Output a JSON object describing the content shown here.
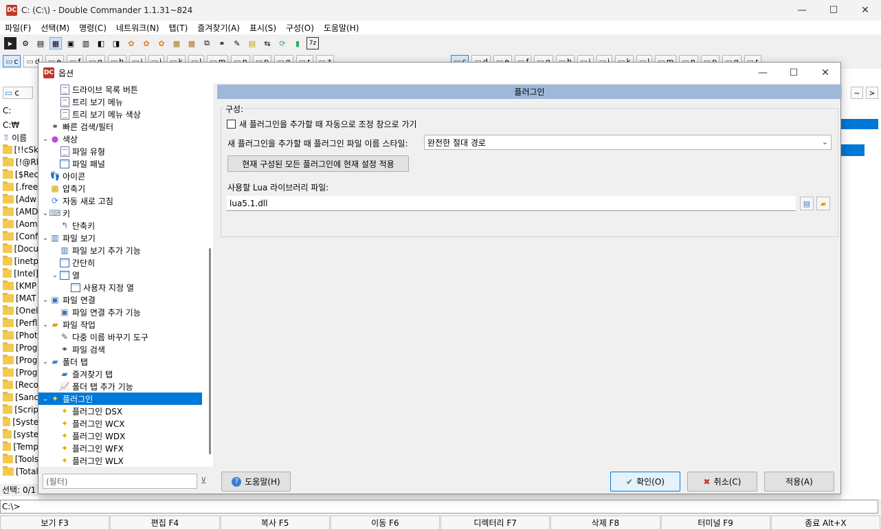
{
  "window": {
    "title": "C: (C:\\) - Double Commander 1.1.31~824",
    "app_icon_text": "DC",
    "minimize": "—",
    "maximize": "☐",
    "close": "✕"
  },
  "menu": [
    "파일(F)",
    "선택(M)",
    "명령(C)",
    "네트워크(N)",
    "탭(T)",
    "즐겨찾기(A)",
    "표시(S)",
    "구성(O)",
    "도움말(H)"
  ],
  "drives_left": [
    "c",
    "d",
    "e",
    "f",
    "g",
    "h",
    "i",
    "j",
    "k",
    "l",
    "m",
    "n",
    "p",
    "q",
    "r",
    "z"
  ],
  "drives_right": [
    "c",
    "d",
    "e",
    "f",
    "g",
    "h",
    "i",
    "j",
    "k",
    "l",
    "m",
    "n",
    "p",
    "q",
    "r"
  ],
  "left_panel": {
    "tab_label": "c",
    "path_combo": "C:",
    "path_text": "C:₩",
    "header": "이름",
    "rows": [
      "[!!cSk",
      "[!@Rl",
      "[$Rec",
      "[.free",
      "[Adw",
      "[AMD",
      "[Aom",
      "[Conf",
      "[Docu",
      "[inetp",
      "[Intel]",
      "[KMP",
      "[MAT",
      "[Onel",
      "[Perfl",
      "[Phot",
      "[Prog",
      "[Prog",
      "[Prog",
      "[Reco",
      "[Sanc",
      "[Scrip",
      "[Syste",
      "[syste",
      "[Temp",
      "[Tools",
      "[Total"
    ],
    "status": "선택: 0/1"
  },
  "second_row_label": "₩₩",
  "cmd_label": "C:\\>",
  "fkeys": [
    "보기 F3",
    "편집 F4",
    "복사 F5",
    "이동 F6",
    "디렉터리 F7",
    "삭제 F8",
    "터미널 F9",
    "종료 Alt+X"
  ],
  "dialog": {
    "title": "옵션",
    "page_title": "플러그인",
    "group_title": "구성:",
    "auto_config_label": "새 플러그인을 추가할 때 자동으로 조정 창으로 가기",
    "filename_style_label": "새 플러그인을 추가할 때 플러그인 파일 이름 스타일:",
    "filename_style_value": "완전한 절대 경로",
    "apply_all_button": "현재 구성된 모든 플러그인에 현재 설정 적용",
    "lua_label": "사용할 Lua 라이브러리 파일:",
    "lua_value": "lua5.1.dll",
    "filter_placeholder": "(필터)",
    "help_button": "도움말(H)",
    "ok_button": "확인(O)",
    "cancel_button": "취소(C)",
    "apply_button": "적용(A)",
    "tree": [
      {
        "label": "드라이브 목록 버튼",
        "level": 2,
        "icon": "doc-icon",
        "expander": ""
      },
      {
        "label": "트리 보기 메뉴",
        "level": 2,
        "icon": "doc-icon",
        "expander": ""
      },
      {
        "label": "트리 보기 메뉴 색상",
        "level": 2,
        "icon": "doc-icon",
        "expander": ""
      },
      {
        "label": "빠른 검색/필터",
        "level": 1,
        "icon": "binoculars-icon",
        "expander": ""
      },
      {
        "label": "색상",
        "level": 1,
        "icon": "color-wheel-icon",
        "expander": "v"
      },
      {
        "label": "파일 유형",
        "level": 2,
        "icon": "doc-icon",
        "expander": ""
      },
      {
        "label": "파일 패널",
        "level": 2,
        "icon": "grid-icon",
        "expander": ""
      },
      {
        "label": "아이콘",
        "level": 1,
        "icon": "footprints-icon",
        "expander": ""
      },
      {
        "label": "압축기",
        "level": 1,
        "icon": "archive-icon",
        "expander": ""
      },
      {
        "label": "자동 새로 고침",
        "level": 1,
        "icon": "refresh-icon",
        "expander": ""
      },
      {
        "label": "키",
        "level": 1,
        "icon": "keyboard-icon",
        "expander": "v"
      },
      {
        "label": "단축키",
        "level": 2,
        "icon": "shortcut-icon",
        "expander": ""
      },
      {
        "label": "파일 보기",
        "level": 1,
        "icon": "panel-icon",
        "expander": "v"
      },
      {
        "label": "파일 보기 추가 기능",
        "level": 2,
        "icon": "panel-icon",
        "expander": ""
      },
      {
        "label": "간단히",
        "level": 2,
        "icon": "grid-icon",
        "expander": ""
      },
      {
        "label": "열",
        "level": 2,
        "icon": "grid-icon",
        "expander": "v"
      },
      {
        "label": "사용자 지정 열",
        "level": 3,
        "icon": "grid-icon",
        "expander": ""
      },
      {
        "label": "파일 연결",
        "level": 1,
        "icon": "file-assoc-icon",
        "expander": "v"
      },
      {
        "label": "파일 연결 추가 기능",
        "level": 2,
        "icon": "file-assoc-icon",
        "expander": ""
      },
      {
        "label": "파일 작업",
        "level": 1,
        "icon": "folder-open-icon",
        "expander": "v"
      },
      {
        "label": "다중 이름 바꾸기 도구",
        "level": 2,
        "icon": "rename-icon",
        "expander": ""
      },
      {
        "label": "파일 검색",
        "level": 2,
        "icon": "binoculars-icon",
        "expander": ""
      },
      {
        "label": "폴더 탭",
        "level": 1,
        "icon": "folder-tab-icon",
        "expander": "v"
      },
      {
        "label": "즐겨찾기 탭",
        "level": 2,
        "icon": "folder-tab-icon",
        "expander": ""
      },
      {
        "label": "폴더 탭 추가 기능",
        "level": 2,
        "icon": "chart-icon",
        "expander": ""
      },
      {
        "label": "플러그인",
        "level": 1,
        "icon": "puzzle-icon",
        "expander": "v",
        "selected": true
      },
      {
        "label": "플러그인 DSX",
        "level": 2,
        "icon": "puzzle-icon",
        "expander": ""
      },
      {
        "label": "플러그인 WCX",
        "level": 2,
        "icon": "puzzle-icon",
        "expander": ""
      },
      {
        "label": "플러그인 WDX",
        "level": 2,
        "icon": "puzzle-icon",
        "expander": ""
      },
      {
        "label": "플러그인 WFX",
        "level": 2,
        "icon": "puzzle-icon",
        "expander": ""
      },
      {
        "label": "플러그인 WLX",
        "level": 2,
        "icon": "puzzle-icon",
        "expander": ""
      }
    ]
  },
  "colors": {
    "accent": "#0078d7",
    "page_header": "#9db8d8",
    "selected_row": "#0078d7"
  }
}
